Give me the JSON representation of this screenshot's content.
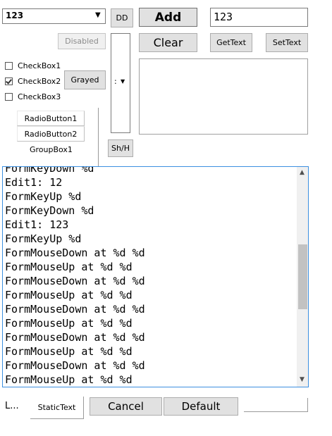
{
  "combo": {
    "value": "123"
  },
  "dd_button": "DD",
  "add_button": "Add",
  "edit1": {
    "value": "123"
  },
  "disabled_button": "Disabled",
  "clear_button": "Clear",
  "gettext_button": "GetText",
  "settext_button": "SetText",
  "checkboxes": [
    {
      "label": "CheckBox1",
      "checked": false
    },
    {
      "label": "CheckBox2",
      "checked": true
    },
    {
      "label": "CheckBox3",
      "checked": false
    }
  ],
  "grayed_button": "Grayed",
  "narrow_combo_value": ":",
  "radios": [
    {
      "label": "RadioButton1"
    },
    {
      "label": "RadioButton2"
    }
  ],
  "groupbox_label": "GroupBox1",
  "shh_button": "Sh/H",
  "log_lines": [
    "FormKeyDown %d",
    "Edit1: 12",
    "FormKeyUp %d",
    "FormKeyDown %d",
    "Edit1: 123",
    "FormKeyUp %d",
    "FormMouseDown at %d %d",
    "FormMouseUp at %d %d",
    "FormMouseDown at %d %d",
    "FormMouseUp at %d %d",
    "FormMouseDown at %d %d",
    "FormMouseUp at %d %d",
    "FormMouseDown at %d %d",
    "FormMouseUp at %d %d",
    "FormMouseDown at %d %d",
    "FormMouseUp at %d %d"
  ],
  "bottom": {
    "label_l": "L...",
    "static_text": "StaticText",
    "cancel_button": "Cancel",
    "default_button": "Default"
  }
}
